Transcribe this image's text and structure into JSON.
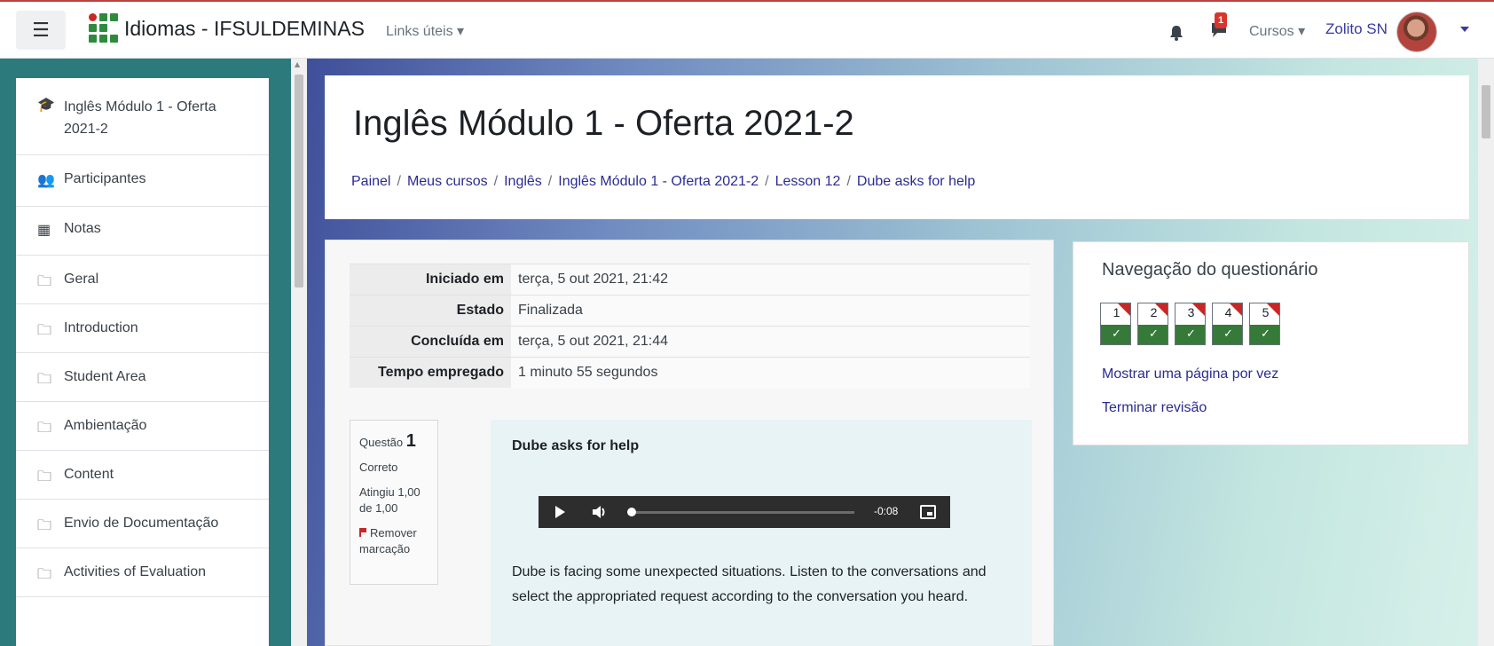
{
  "navbar": {
    "brand": "Idiomas - IFSULDEMINAS",
    "links_menu": "Links úteis",
    "notification_count": "1",
    "courses_menu": "Cursos",
    "user_name": "Zolito SN"
  },
  "sidebar": {
    "items": [
      {
        "label": "Inglês Módulo 1 - Oferta 2021-2",
        "icon": "graduation-cap-icon"
      },
      {
        "label": "Participantes",
        "icon": "users-icon"
      },
      {
        "label": "Notas",
        "icon": "table-icon"
      },
      {
        "label": "Geral",
        "icon": "folder-icon"
      },
      {
        "label": "Introduction",
        "icon": "folder-icon"
      },
      {
        "label": "Student Area",
        "icon": "folder-icon"
      },
      {
        "label": "Ambientação",
        "icon": "folder-icon"
      },
      {
        "label": "Content",
        "icon": "folder-icon"
      },
      {
        "label": "Envio de Documentação",
        "icon": "folder-icon"
      },
      {
        "label": "Activities of Evaluation",
        "icon": "folder-icon"
      }
    ]
  },
  "header": {
    "title": "Inglês Módulo 1 - Oferta 2021-2",
    "breadcrumb": [
      "Painel",
      "Meus cursos",
      "Inglês",
      "Inglês Módulo 1 - Oferta 2021-2",
      "Lesson 12",
      "Dube asks for help"
    ]
  },
  "summary": {
    "rows": [
      {
        "label": "Iniciado em",
        "value": "terça, 5 out 2021, 21:42"
      },
      {
        "label": "Estado",
        "value": "Finalizada"
      },
      {
        "label": "Concluída em",
        "value": "terça, 5 out 2021, 21:44"
      },
      {
        "label": "Tempo empregado",
        "value": "1 minuto 55 segundos"
      }
    ]
  },
  "question": {
    "label": "Questão",
    "number": "1",
    "status": "Correto",
    "grade": "Atingiu 1,00 de 1,00",
    "flag_label": "Remover marcação",
    "name": "Dube asks for help",
    "audio_time": "-0:08",
    "text": "Dube is facing some unexpected situations. Listen to the conversations and select the appropriated request according to the conversation you heard."
  },
  "quiz_nav": {
    "title": "Navegação do questionário",
    "questions": [
      "1",
      "2",
      "3",
      "4",
      "5"
    ],
    "show_one_page": "Mostrar uma página por vez",
    "finish_review": "Terminar revisão"
  }
}
